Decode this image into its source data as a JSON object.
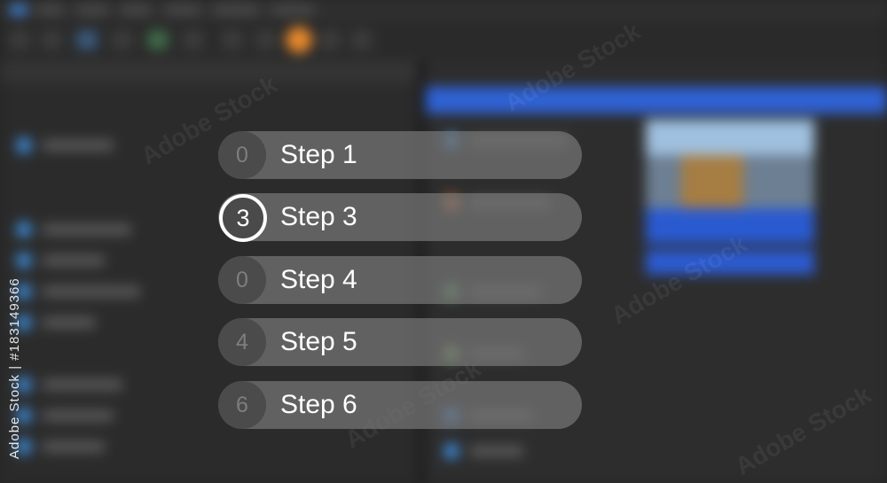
{
  "steps": [
    {
      "number": "0",
      "label": "Step 1",
      "active": false
    },
    {
      "number": "3",
      "label": "Step 3",
      "active": true
    },
    {
      "number": "0",
      "label": "Step 4",
      "active": false
    },
    {
      "number": "4",
      "label": "Step 5",
      "active": false
    },
    {
      "number": "6",
      "label": "Step 6",
      "active": false
    }
  ],
  "overlay": {
    "watermark_text": "Adobe Stock",
    "stock_id": "Adobe Stock | #183149366"
  },
  "colors": {
    "background": "#262626",
    "pill": "#767676",
    "active_ring": "#ffffff",
    "background_accent_blue": "#2f62d4",
    "background_accent_orange": "#e8892c"
  }
}
